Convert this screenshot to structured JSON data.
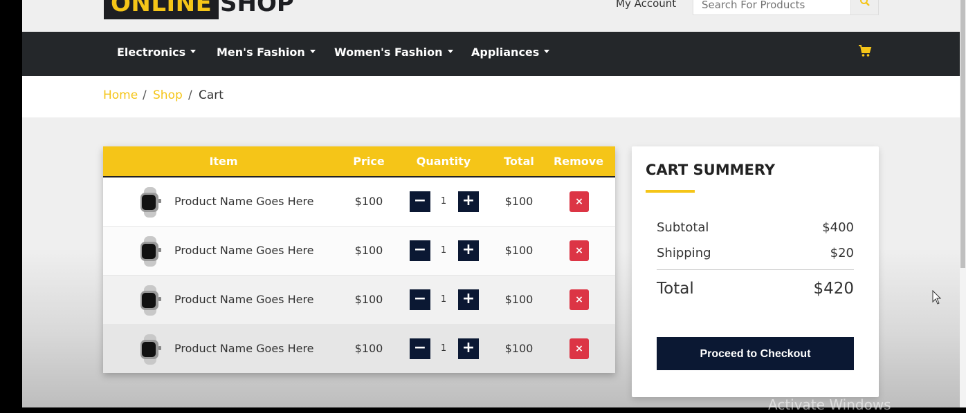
{
  "brand": {
    "part1": "ONLINE",
    "part2": "SHOP"
  },
  "header": {
    "my_account": "My Account",
    "search_placeholder": "Search For Products"
  },
  "nav": {
    "items": [
      {
        "label": "Electronics"
      },
      {
        "label": "Men's Fashion"
      },
      {
        "label": "Women's Fashion"
      },
      {
        "label": "Appliances"
      }
    ],
    "cart_icon": "shopping-cart-icon"
  },
  "breadcrumb": {
    "home": "Home",
    "sep1": "/",
    "shop": "Shop",
    "sep2": "/",
    "current": "Cart"
  },
  "cart_table": {
    "headers": {
      "item": "Item",
      "price": "Price",
      "quantity": "Quantity",
      "total": "Total",
      "remove": "Remove"
    },
    "rows": [
      {
        "name": "Product Name Goes Here",
        "price": "$100",
        "qty": "1",
        "total": "$100",
        "remove": "×"
      },
      {
        "name": "Product Name Goes Here",
        "price": "$100",
        "qty": "1",
        "total": "$100",
        "remove": "×"
      },
      {
        "name": "Product Name Goes Here",
        "price": "$100",
        "qty": "1",
        "total": "$100",
        "remove": "×"
      },
      {
        "name": "Product Name Goes Here",
        "price": "$100",
        "qty": "1",
        "total": "$100",
        "remove": "×"
      }
    ],
    "minus": "−",
    "plus": "+"
  },
  "summary": {
    "title": "CART SUMMERY",
    "subtotal_label": "Subtotal",
    "subtotal_value": "$400",
    "shipping_label": "Shipping",
    "shipping_value": "$20",
    "total_label": "Total",
    "total_value": "$420",
    "checkout": "Proceed to Checkout"
  },
  "watermark": "Activate Windows",
  "colors": {
    "accent": "#f5c518",
    "nav_bg": "#24272a",
    "dark_btn": "#0b1833",
    "remove_red": "#dc3545"
  }
}
